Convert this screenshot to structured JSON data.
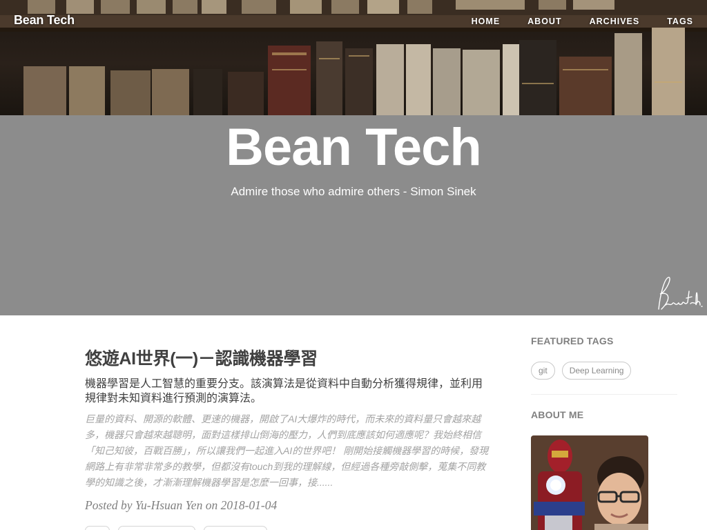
{
  "nav": {
    "brand": "Bean Tech",
    "items": [
      {
        "label": "HOME"
      },
      {
        "label": "ABOUT"
      },
      {
        "label": "ARCHIVES"
      },
      {
        "label": "TAGS"
      }
    ]
  },
  "header": {
    "title": "Bean Tech",
    "subtitle": "Admire those who admire others - Simon Sinek",
    "signature": "Beantech."
  },
  "post": {
    "title": "悠遊AI世界(一)－認識機器學習",
    "subtitle": "機器學習是人工智慧的重要分支。該演算法是從資料中自動分析獲得規律，並利用規律對未知資料進行預測的演算法。",
    "excerpt": "巨量的資料、開源的軟體、更速的機器，開啟了AI大爆炸的時代，而未來的資料量只會越來越多，機器只會越來越聰明，面對這樣排山倒海的壓力，人們到底應該如何適應呢？我始終相信「知己知彼，百戰百勝」，所以讓我們一起進入AI的世界吧！ 剛開始接觸機器學習的時候，發現網路上有非常非常多的教學，但都沒有touch到我的理解線，但經過各種旁敲側擊，蒐集不同教學的知識之後，才漸漸理解機器學習是怎麼一回事，接......",
    "meta": "Posted by Yu-Hsuan Yen on 2018-01-04"
  },
  "sidebar": {
    "featured_tags_heading": "FEATURED TAGS",
    "tags": [
      {
        "label": "git"
      },
      {
        "label": "Deep Learning"
      }
    ],
    "about_heading": "ABOUT ME"
  },
  "colors": {
    "hero_band": "#8c8c8c",
    "text": "#404040",
    "excerpt": "#a3a3a3"
  }
}
